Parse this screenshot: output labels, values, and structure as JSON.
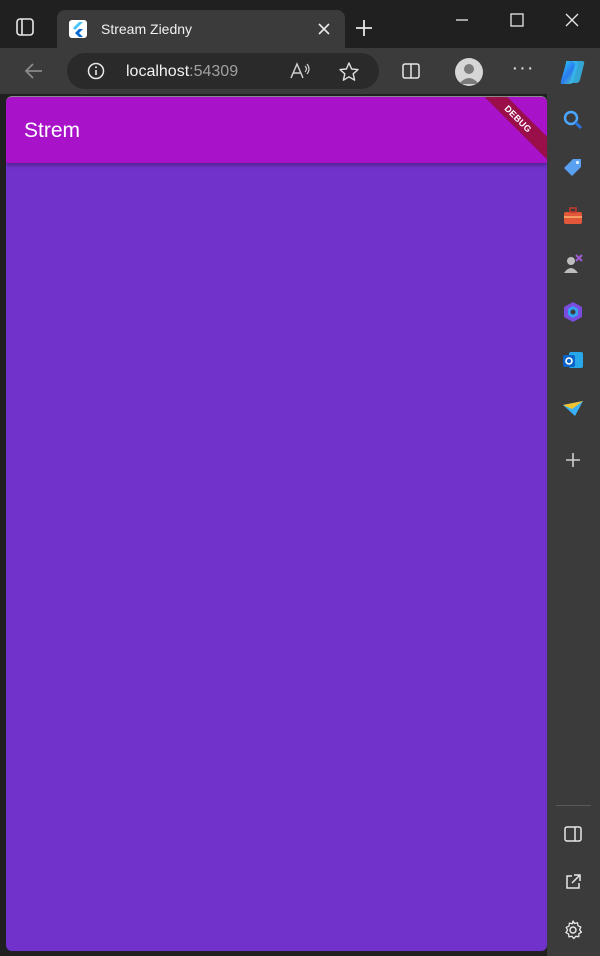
{
  "browser": {
    "tab": {
      "title": "Stream Ziedny"
    },
    "address": {
      "host": "localhost",
      "port": ":54309"
    },
    "icons": {
      "tab_actions": "tab-actions-icon",
      "favicon": "flutter-icon",
      "close": "close-icon",
      "new_tab": "plus-icon",
      "back": "back-arrow-icon",
      "info": "info-icon",
      "read_aloud": "read-aloud-icon",
      "favorite": "star-icon",
      "split_screen": "split-screen-icon",
      "profile": "profile-icon",
      "more": "more-icon",
      "copilot": "copilot-icon"
    },
    "more_label": "···"
  },
  "sidebar": {
    "items": [
      "search-icon",
      "shopping-tag-icon",
      "tools-icon",
      "games-icon",
      "microsoft-365-icon",
      "outlook-icon",
      "drop-icon",
      "add-icon"
    ],
    "bottom": [
      "sidebar-toggle-icon",
      "external-link-icon",
      "settings-icon"
    ]
  },
  "app": {
    "title": "Strem",
    "debug_label": "DEBUG",
    "colors": {
      "appbar": "#a813c9",
      "body": "#7132cc",
      "debug": "#9a0e4a"
    }
  }
}
